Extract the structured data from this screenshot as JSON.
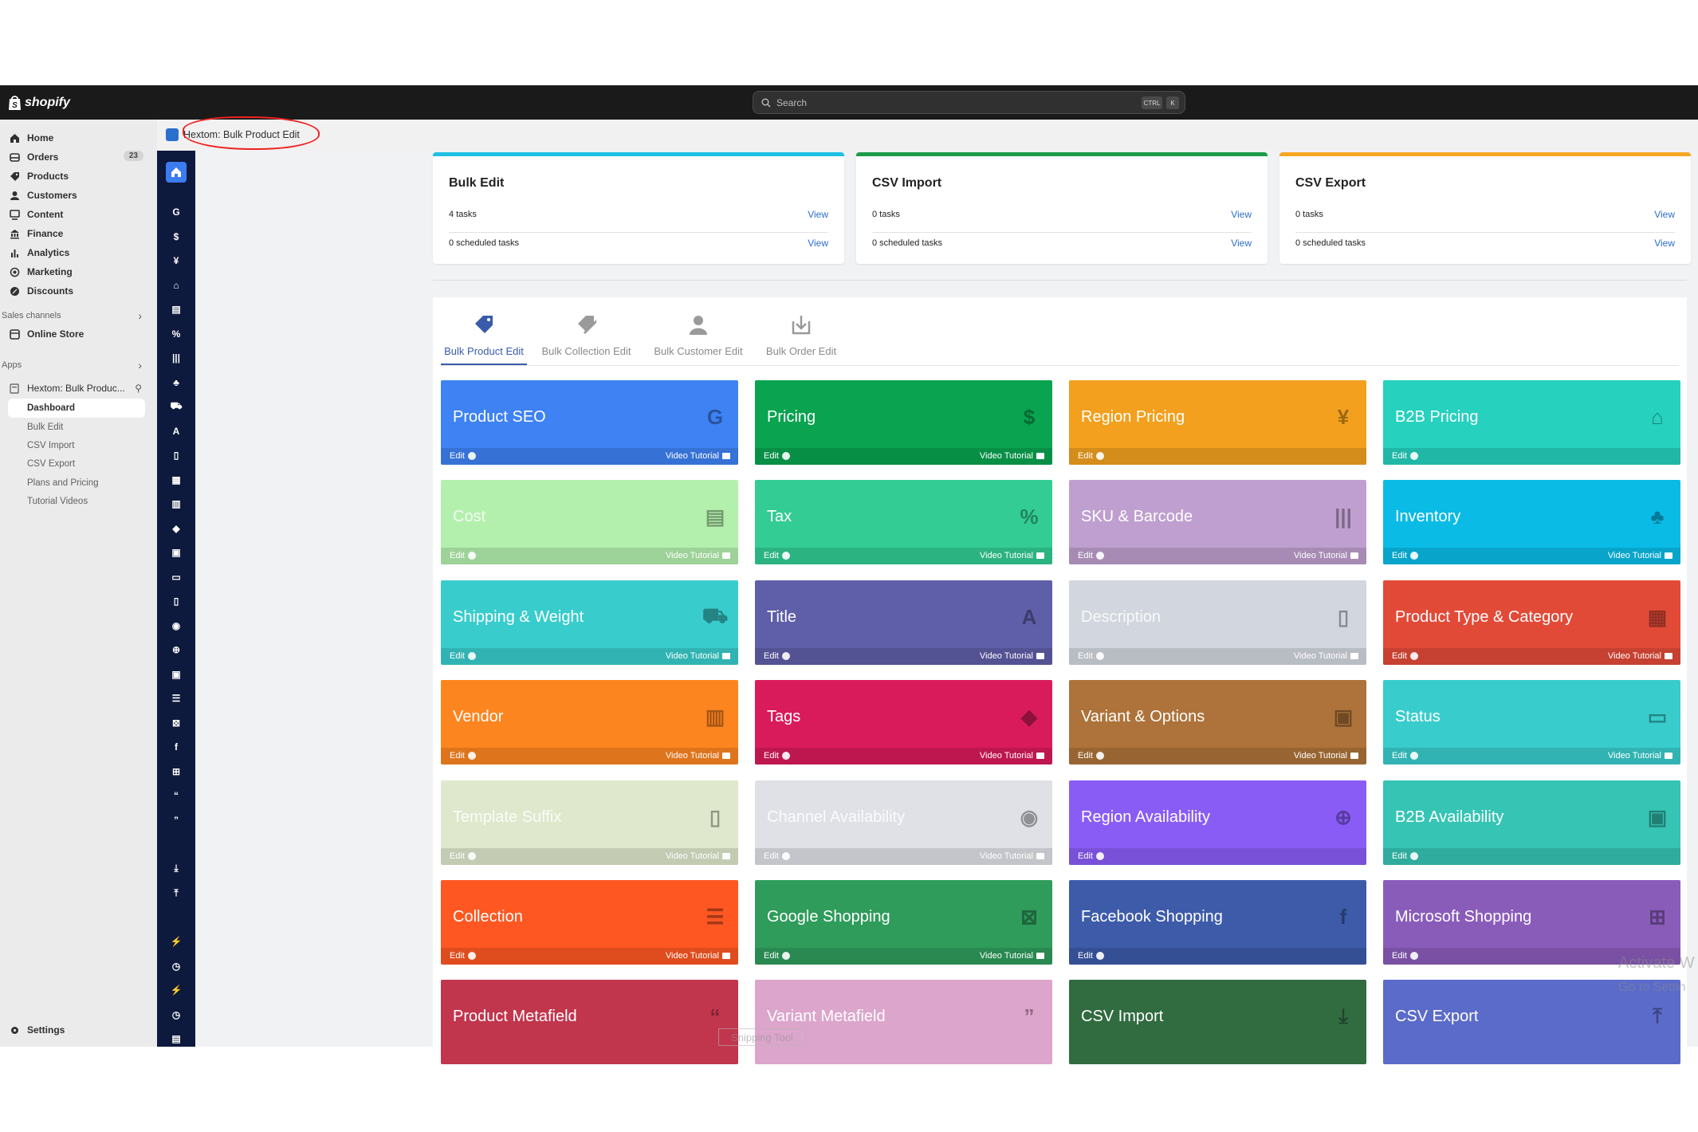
{
  "topbar": {
    "logo": "shopify",
    "search_placeholder": "Search",
    "shortcut": [
      "CTRL",
      "K"
    ]
  },
  "sidebar": {
    "items": [
      {
        "label": "Home",
        "icon": "home-icon"
      },
      {
        "label": "Orders",
        "icon": "orders-icon",
        "badge": "23"
      },
      {
        "label": "Products",
        "icon": "tag-icon"
      },
      {
        "label": "Customers",
        "icon": "person-icon"
      },
      {
        "label": "Content",
        "icon": "content-icon"
      },
      {
        "label": "Finance",
        "icon": "bank-icon"
      },
      {
        "label": "Analytics",
        "icon": "chart-icon"
      },
      {
        "label": "Marketing",
        "icon": "target-icon"
      },
      {
        "label": "Discounts",
        "icon": "discount-icon"
      }
    ],
    "sales_channels_label": "Sales channels",
    "online_store": "Online Store",
    "apps_label": "Apps",
    "app_name": "Hextom: Bulk Produc...",
    "app_subitems": [
      "Dashboard",
      "Bulk Edit",
      "CSV Import",
      "CSV Export",
      "Plans and Pricing",
      "Tutorial Videos"
    ],
    "settings": "Settings"
  },
  "title_strip": {
    "title": "Hextom: Bulk Product Edit"
  },
  "iconbar": {
    "glyphs": [
      "G",
      "$",
      "¥",
      "⌂",
      "▤",
      "%",
      "|||",
      "♣",
      "⛟",
      "A",
      "▯",
      "▦",
      "▥",
      "◆",
      "▣",
      "▭",
      "▯",
      "◉",
      "⊕",
      "▣",
      "☰",
      "⊠",
      "f",
      "⊞",
      "“",
      "”",
      "",
      "⤓",
      "⤒",
      "",
      "⚡",
      "◷",
      "⚡",
      "◷",
      "▤"
    ]
  },
  "stats": [
    {
      "title": "Bulk Edit",
      "row1": "4 tasks",
      "row2": "0 scheduled tasks",
      "view": "View",
      "color": "#1ec0e3"
    },
    {
      "title": "CSV Import",
      "row1": "0 tasks",
      "row2": "0 scheduled tasks",
      "view": "View",
      "color": "#1e9b4a"
    },
    {
      "title": "CSV Export",
      "row1": "0 tasks",
      "row2": "0 scheduled tasks",
      "view": "View",
      "color": "#f5a623"
    }
  ],
  "tabs": [
    "Bulk Product Edit",
    "Bulk Collection Edit",
    "Bulk Customer Edit",
    "Bulk Order Edit"
  ],
  "tile_labels": {
    "edit": "Edit",
    "video": "Video Tutorial"
  },
  "tiles": [
    {
      "name": "Product SEO",
      "color": "#3e82f4",
      "icon": "G",
      "video": true
    },
    {
      "name": "Pricing",
      "color": "#0aa350",
      "icon": "$",
      "video": true
    },
    {
      "name": "Region Pricing",
      "color": "#f2a01e",
      "icon": "¥",
      "video": false
    },
    {
      "name": "B2B Pricing",
      "color": "#26d1be",
      "icon": "⌂",
      "video": false
    },
    {
      "name": "Cost",
      "color": "#b3f0ad",
      "icon": "▤",
      "video": true
    },
    {
      "name": "Tax",
      "color": "#33cc94",
      "icon": "%",
      "video": true
    },
    {
      "name": "SKU & Barcode",
      "color": "#bf9fcf",
      "icon": "|||",
      "video": true
    },
    {
      "name": "Inventory",
      "color": "#0abbe6",
      "icon": "♣",
      "video": true
    },
    {
      "name": "Shipping & Weight",
      "color": "#39cccc",
      "icon": "⛟",
      "video": true
    },
    {
      "name": "Title",
      "color": "#5f5ea8",
      "icon": "A",
      "video": true
    },
    {
      "name": "Description",
      "color": "#d2d6de",
      "icon": "▯",
      "video": true
    },
    {
      "name": "Product Type & Category",
      "color": "#e24a38",
      "icon": "▦",
      "video": true
    },
    {
      "name": "Vendor",
      "color": "#fd8520",
      "icon": "▥",
      "video": true
    },
    {
      "name": "Tags",
      "color": "#d91b5c",
      "icon": "◆",
      "video": true
    },
    {
      "name": "Variant & Options",
      "color": "#ad733a",
      "icon": "▣",
      "video": true
    },
    {
      "name": "Status",
      "color": "#39cccc",
      "icon": "▭",
      "video": true
    },
    {
      "name": "Template Suffix",
      "color": "#dfe8cc",
      "icon": "▯",
      "video": true
    },
    {
      "name": "Channel Availability",
      "color": "#dfe1e6",
      "icon": "◉",
      "video": true
    },
    {
      "name": "Region Availability",
      "color": "#8a5cf6",
      "icon": "⊕",
      "video": false
    },
    {
      "name": "B2B Availability",
      "color": "#36c4b4",
      "icon": "▣",
      "video": false
    },
    {
      "name": "Collection",
      "color": "#fe5722",
      "icon": "☰",
      "video": true
    },
    {
      "name": "Google Shopping",
      "color": "#2f9c5c",
      "icon": "⊠",
      "video": true
    },
    {
      "name": "Facebook Shopping",
      "color": "#3d5ba9",
      "icon": "f",
      "video": false
    },
    {
      "name": "Microsoft Shopping",
      "color": "#8a5cba",
      "icon": "⊞",
      "video": false
    },
    {
      "name": "Product Metafield",
      "color": "#c1354d",
      "icon": "“",
      "video": false
    },
    {
      "name": "Variant Metafield",
      "color": "#dca5cb",
      "icon": "”",
      "video": false
    },
    {
      "name": "CSV Import",
      "color": "#316c41",
      "icon": "⤓",
      "video": false
    },
    {
      "name": "CSV Export",
      "color": "#5b6bca",
      "icon": "⤒",
      "video": false
    }
  ],
  "watermark": {
    "line1": "Activate W",
    "line2": "Go to Settin"
  },
  "snip_label": "Snipping Tool"
}
